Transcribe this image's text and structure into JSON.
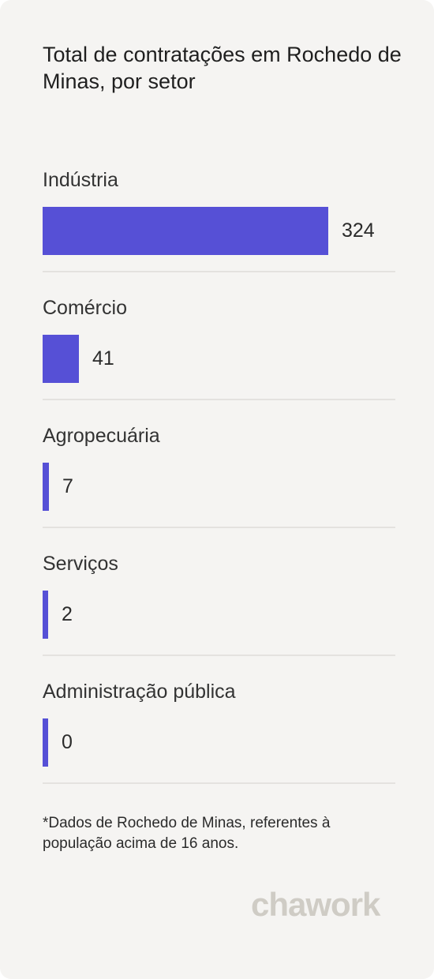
{
  "chart_data": {
    "type": "bar",
    "orientation": "horizontal",
    "title": "Total de contratações em Rochedo de Minas, por setor",
    "categories": [
      "Indústria",
      "Comércio",
      "Agropecuária",
      "Serviços",
      "Administração pública"
    ],
    "values": [
      324,
      41,
      7,
      2,
      0
    ],
    "value_labels": [
      "324",
      "41",
      "7",
      "2",
      "0"
    ],
    "bar_color": "#5650d6"
  },
  "footnote": "*Dados de Rochedo de Minas, referentes à população acima de 16 anos.",
  "logo": "chawork"
}
